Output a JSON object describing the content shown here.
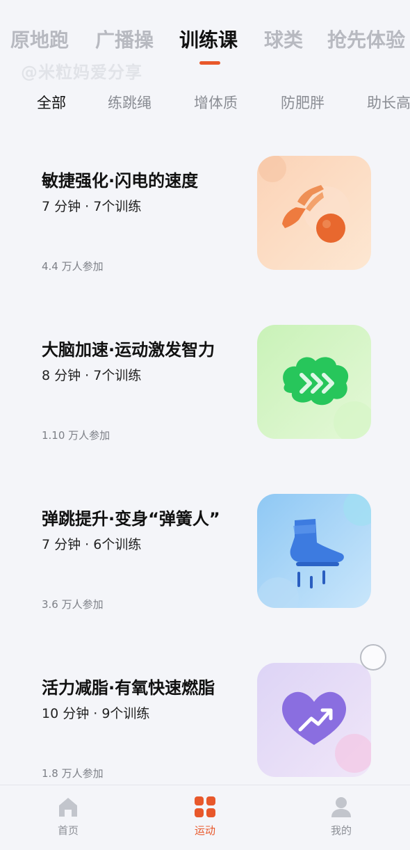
{
  "top_tabs": [
    "原地跑",
    "广播操",
    "训练课",
    "球类",
    "抢先体验"
  ],
  "top_tab_active": "训练课",
  "watermark": "@米粒妈爱分享",
  "sub_tabs": [
    "全部",
    "练跳绳",
    "增体质",
    "防肥胖",
    "助长高"
  ],
  "sub_tab_active": "全部",
  "courses": [
    {
      "title": "敏捷强化·闪电的速度",
      "meta": "7 分钟 · 7个训练",
      "participants": "4.4 万人参加",
      "thumb_icon": "hand-ball-icon"
    },
    {
      "title": "大脑加速·运动激发智力",
      "meta": "8 分钟 · 7个训练",
      "participants": "1.10 万人参加",
      "thumb_icon": "brain-icon"
    },
    {
      "title": "弹跳提升·变身“弹簧人”",
      "meta": "7 分钟 · 6个训练",
      "participants": "3.6 万人参加",
      "thumb_icon": "foot-icon"
    },
    {
      "title": "活力减脂·有氧快速燃脂",
      "meta": "10 分钟 · 9个训练",
      "participants": "1.8 万人参加",
      "thumb_icon": "heart-trend-icon"
    }
  ],
  "bottom_nav": [
    {
      "label": "首页",
      "icon": "home-icon"
    },
    {
      "label": "运动",
      "icon": "sport-grid-icon"
    },
    {
      "label": "我的",
      "icon": "profile-icon"
    }
  ],
  "bottom_nav_active": "运动",
  "colors": {
    "accent": "#e8582b",
    "inactive": "#b7b9c0",
    "background": "#f4f5f9"
  }
}
